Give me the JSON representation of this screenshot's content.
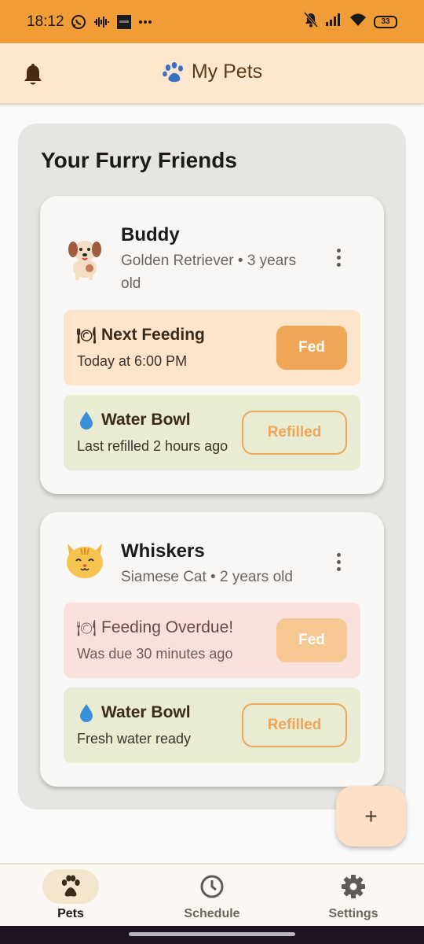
{
  "status_bar": {
    "time": "18:12",
    "battery": "33",
    "icons": [
      "whatsapp-icon",
      "voicemail-icon",
      "app-notification-icon",
      "more-dots-icon",
      "mute-icon",
      "signal-icon",
      "wifi-icon",
      "battery-icon"
    ]
  },
  "app_bar": {
    "title": "My Pets",
    "left_icon": "bell-icon",
    "title_icon": "paw-icon"
  },
  "main": {
    "section_title": "Your Furry Friends",
    "pets": [
      {
        "name": "Buddy",
        "subtitle": "Golden Retriever • 3 years old",
        "avatar": "dog-icon",
        "feeding": {
          "title": "Next Feeding",
          "subtitle": "Today at 6:00 PM",
          "button": "Fed",
          "state": "upcoming"
        },
        "water": {
          "title": "Water Bowl",
          "subtitle": "Last refilled 2 hours ago",
          "button": "Refilled"
        }
      },
      {
        "name": "Whiskers",
        "subtitle": "Siamese Cat • 2 years old",
        "avatar": "cat-icon",
        "feeding": {
          "title": "Feeding Overdue!",
          "subtitle": "Was due 30 minutes ago",
          "button": "Fed",
          "state": "overdue"
        },
        "water": {
          "title": "Water Bowl",
          "subtitle": "Fresh water ready",
          "button": "Refilled"
        }
      }
    ]
  },
  "fab": {
    "label": "+"
  },
  "bottom_nav": {
    "items": [
      {
        "label": "Pets",
        "icon": "paw-icon",
        "active": true
      },
      {
        "label": "Schedule",
        "icon": "clock-icon",
        "active": false
      },
      {
        "label": "Settings",
        "icon": "gear-icon",
        "active": false
      }
    ]
  },
  "colors": {
    "status_bar": "#f19d37",
    "app_bar": "#fde7cf",
    "accent": "#efa656",
    "feed_row": "#fde4ca",
    "overdue_row": "#f8e1dd",
    "water_row": "#e9ebd3"
  }
}
